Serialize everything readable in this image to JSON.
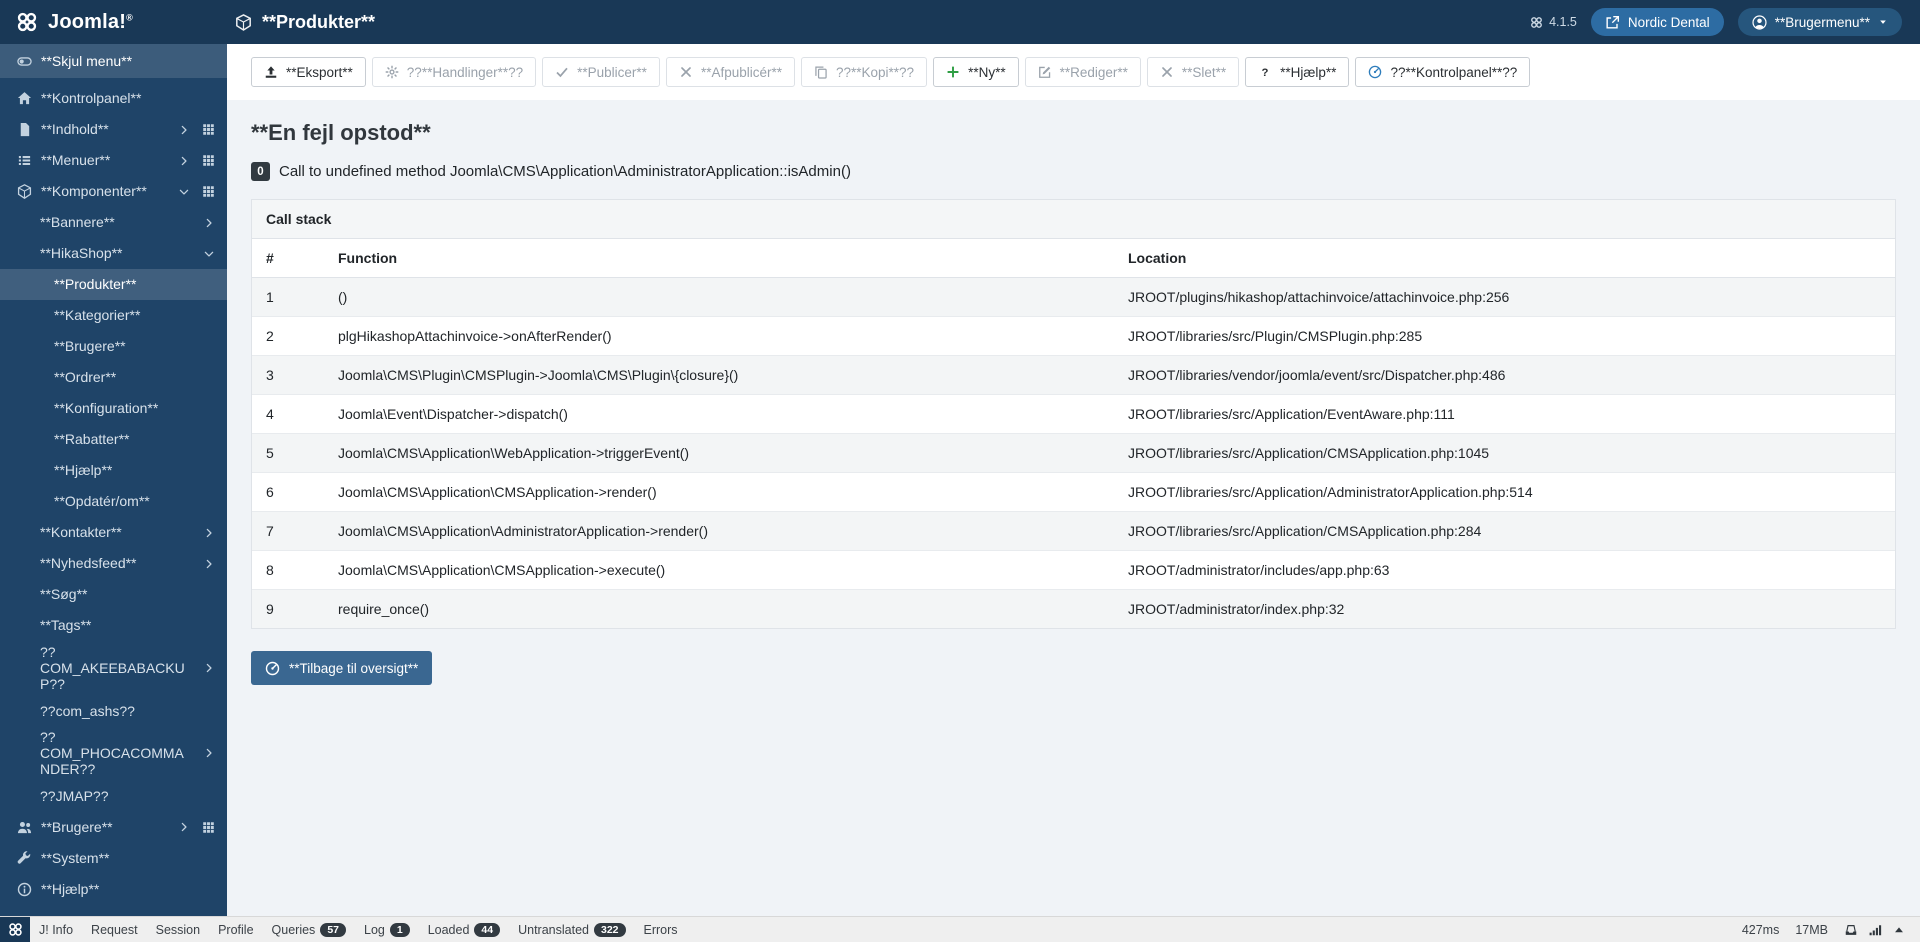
{
  "header": {
    "logo": "Joomla!",
    "logo_reg": "®",
    "page_title": "**Produkter**",
    "version": "4.1.5",
    "site_name": "Nordic Dental",
    "user_menu_label": "**Brugermenu**"
  },
  "sidebar": {
    "toggle_label": "**Skjul menu**",
    "toggle_icon": "toggle",
    "items": [
      {
        "label": "**Kontrolpanel**",
        "level": 0,
        "icon": "home"
      },
      {
        "label": "**Indhold**",
        "level": 0,
        "icon": "file",
        "chevron": "right",
        "grid": true
      },
      {
        "label": "**Menuer**",
        "level": 0,
        "icon": "list",
        "chevron": "right",
        "grid": true
      },
      {
        "label": "**Komponenter**",
        "level": 0,
        "icon": "cube",
        "chevron": "down",
        "grid": true
      },
      {
        "label": "**Bannere**",
        "level": 1,
        "chevron": "right"
      },
      {
        "label": "**HikaShop**",
        "level": 1,
        "chevron": "down"
      },
      {
        "label": "**Produkter**",
        "level": 2,
        "active": true
      },
      {
        "label": "**Kategorier**",
        "level": 2
      },
      {
        "label": "**Brugere**",
        "level": 2
      },
      {
        "label": "**Ordrer**",
        "level": 2
      },
      {
        "label": "**Konfiguration**",
        "level": 2
      },
      {
        "label": "**Rabatter**",
        "level": 2
      },
      {
        "label": "**Hjælp**",
        "level": 2
      },
      {
        "label": "**Opdatér/om**",
        "level": 2
      },
      {
        "label": "**Kontakter**",
        "level": 1,
        "chevron": "right"
      },
      {
        "label": "**Nyhedsfeed**",
        "level": 1,
        "chevron": "right"
      },
      {
        "label": "**Søg**",
        "level": 1
      },
      {
        "label": "**Tags**",
        "level": 1
      },
      {
        "label": "??COM_AKEEBABACKUP??",
        "level": 1,
        "chevron": "right"
      },
      {
        "label": "??com_ashs??",
        "level": 1
      },
      {
        "label": "??COM_PHOCACOMMANDER??",
        "level": 1,
        "chevron": "right"
      },
      {
        "label": "??JMAP??",
        "level": 1
      },
      {
        "label": "**Brugere**",
        "level": 0,
        "icon": "users",
        "chevron": "right",
        "grid": true
      },
      {
        "label": "**System**",
        "level": 0,
        "icon": "wrench"
      },
      {
        "label": "**Hjælp**",
        "level": 0,
        "icon": "info"
      }
    ]
  },
  "toolbar": {
    "buttons": [
      {
        "label": "**Eksport**",
        "icon": "upload",
        "disabled": false
      },
      {
        "label": "??**Handlinger**??",
        "icon": "cogs",
        "disabled": true
      },
      {
        "label": "**Publicer**",
        "icon": "check",
        "disabled": true
      },
      {
        "label": "**Afpublicér**",
        "icon": "close",
        "disabled": true
      },
      {
        "label": "??**Kopi**??",
        "icon": "copy",
        "disabled": true
      },
      {
        "label": "**Ny**",
        "icon": "plus",
        "disabled": false,
        "icon_color": "#2f9e44"
      },
      {
        "label": "**Rediger**",
        "icon": "edit",
        "disabled": true
      },
      {
        "label": "**Slet**",
        "icon": "close",
        "disabled": true
      },
      {
        "label": "**Hjælp**",
        "icon": "question",
        "disabled": false
      },
      {
        "label": "??**Kontrolpanel**??",
        "icon": "gauge",
        "disabled": false,
        "icon_color": "#2d7cbb"
      }
    ]
  },
  "main": {
    "error_title": "**En fejl opstod**",
    "error_code": "0",
    "error_message": "Call to undefined method Joomla\\CMS\\Application\\AdministratorApplication::isAdmin()",
    "callstack": {
      "caption": "Call stack",
      "columns": [
        "#",
        "Function",
        "Location"
      ],
      "rows": [
        {
          "n": "1",
          "function": "()",
          "location": "JROOT/plugins/hikashop/attachinvoice/attachinvoice.php:256"
        },
        {
          "n": "2",
          "function": "plgHikashopAttachinvoice->onAfterRender()",
          "location": "JROOT/libraries/src/Plugin/CMSPlugin.php:285"
        },
        {
          "n": "3",
          "function": "Joomla\\CMS\\Plugin\\CMSPlugin->Joomla\\CMS\\Plugin\\{closure}()",
          "location": "JROOT/libraries/vendor/joomla/event/src/Dispatcher.php:486"
        },
        {
          "n": "4",
          "function": "Joomla\\Event\\Dispatcher->dispatch()",
          "location": "JROOT/libraries/src/Application/EventAware.php:111"
        },
        {
          "n": "5",
          "function": "Joomla\\CMS\\Application\\WebApplication->triggerEvent()",
          "location": "JROOT/libraries/src/Application/CMSApplication.php:1045"
        },
        {
          "n": "6",
          "function": "Joomla\\CMS\\Application\\CMSApplication->render()",
          "location": "JROOT/libraries/src/Application/AdministratorApplication.php:514"
        },
        {
          "n": "7",
          "function": "Joomla\\CMS\\Application\\AdministratorApplication->render()",
          "location": "JROOT/libraries/src/Application/CMSApplication.php:284"
        },
        {
          "n": "8",
          "function": "Joomla\\CMS\\Application\\CMSApplication->execute()",
          "location": "JROOT/administrator/includes/app.php:63"
        },
        {
          "n": "9",
          "function": "require_once()",
          "location": "JROOT/administrator/index.php:32"
        }
      ]
    },
    "back_button": "**Tilbage til oversigt**"
  },
  "statusbar": {
    "items": [
      {
        "label": "J! Info"
      },
      {
        "label": "Request"
      },
      {
        "label": "Session"
      },
      {
        "label": "Profile"
      },
      {
        "label": "Queries",
        "badge": "57"
      },
      {
        "label": "Log",
        "badge": "1"
      },
      {
        "label": "Loaded",
        "badge": "44"
      },
      {
        "label": "Untranslated",
        "badge": "322"
      },
      {
        "label": "Errors"
      }
    ],
    "time": "427ms",
    "memory": "17MB",
    "right_icons": [
      "tray",
      "signal",
      "caret-up"
    ]
  },
  "colors": {
    "header_bg": "#193856",
    "sidebar_bg": "#1f4468",
    "site_pill": "#2d6ca3",
    "primary_button": "#3a6791",
    "badge_dark": "#323a41",
    "success_green": "#2f9e44",
    "info_blue": "#2d7cbb"
  }
}
